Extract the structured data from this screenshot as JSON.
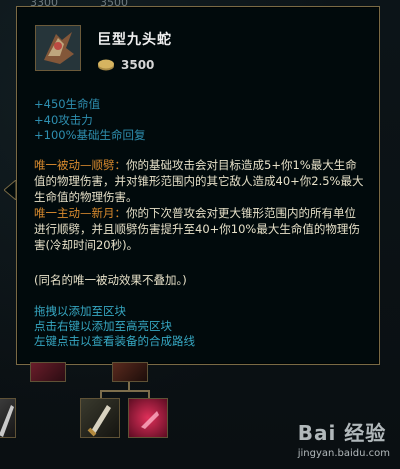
{
  "background": {
    "top_numbers": [
      "3300",
      "3500"
    ]
  },
  "tooltip": {
    "item_name": "巨型九头蛇",
    "price": "3500",
    "stats": [
      "+450生命值",
      "+40攻击力",
      "+100%基础生命回复"
    ],
    "passive_1": {
      "label": "唯一被动—顺劈：",
      "text": "你的基础攻击会对目标造成5+你1%最大生命值的物理伤害，并对锥形范围内的其它敌人造成40+你2.5%最大生命值的物理伤害。"
    },
    "passive_2": {
      "label": "唯一主动—新月：",
      "text": "你的下次普攻会对更大锥形范围内的所有单位进行顺劈，并且顺劈伤害提升至40+你10%最大生命值的物理伤害(冷却时间20秒)。"
    },
    "note": "(同名的唯一被动效果不叠加。)",
    "hints": [
      "拖拽以添加至区块",
      "点击右键以添加至高亮区块",
      "左键点击以查看装备的合成路线"
    ]
  },
  "watermark": {
    "main": "Bai 经验",
    "sub": "jingyan.baidu.com"
  },
  "colors": {
    "border": "#7a6a45",
    "stat_blue": "#2e8fb0",
    "passive_orange": "#d88a2e",
    "hint_cyan": "#36a7c2"
  }
}
